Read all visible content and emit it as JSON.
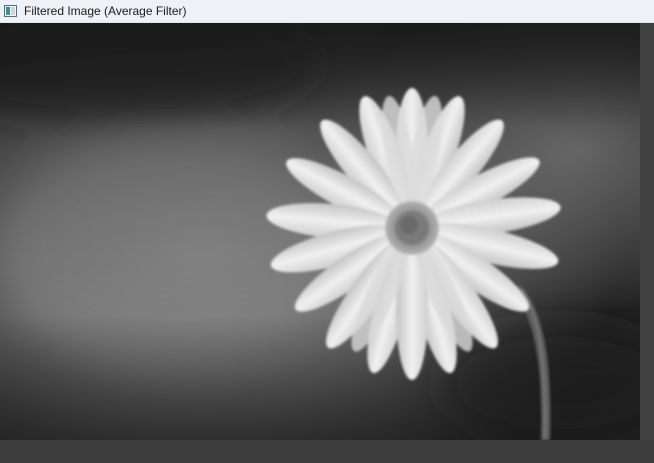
{
  "window": {
    "title": "Filtered Image (Average Filter)",
    "icon": "opencv-window-icon"
  },
  "image": {
    "icon": "filtered-photo-daisy",
    "colors": {
      "background_dark": "#1e1e1e",
      "background_mid": "#7a7a7a",
      "petal": "#e6e6e6",
      "center": "#8a8a8a",
      "stem": "#5a5a5a"
    }
  }
}
